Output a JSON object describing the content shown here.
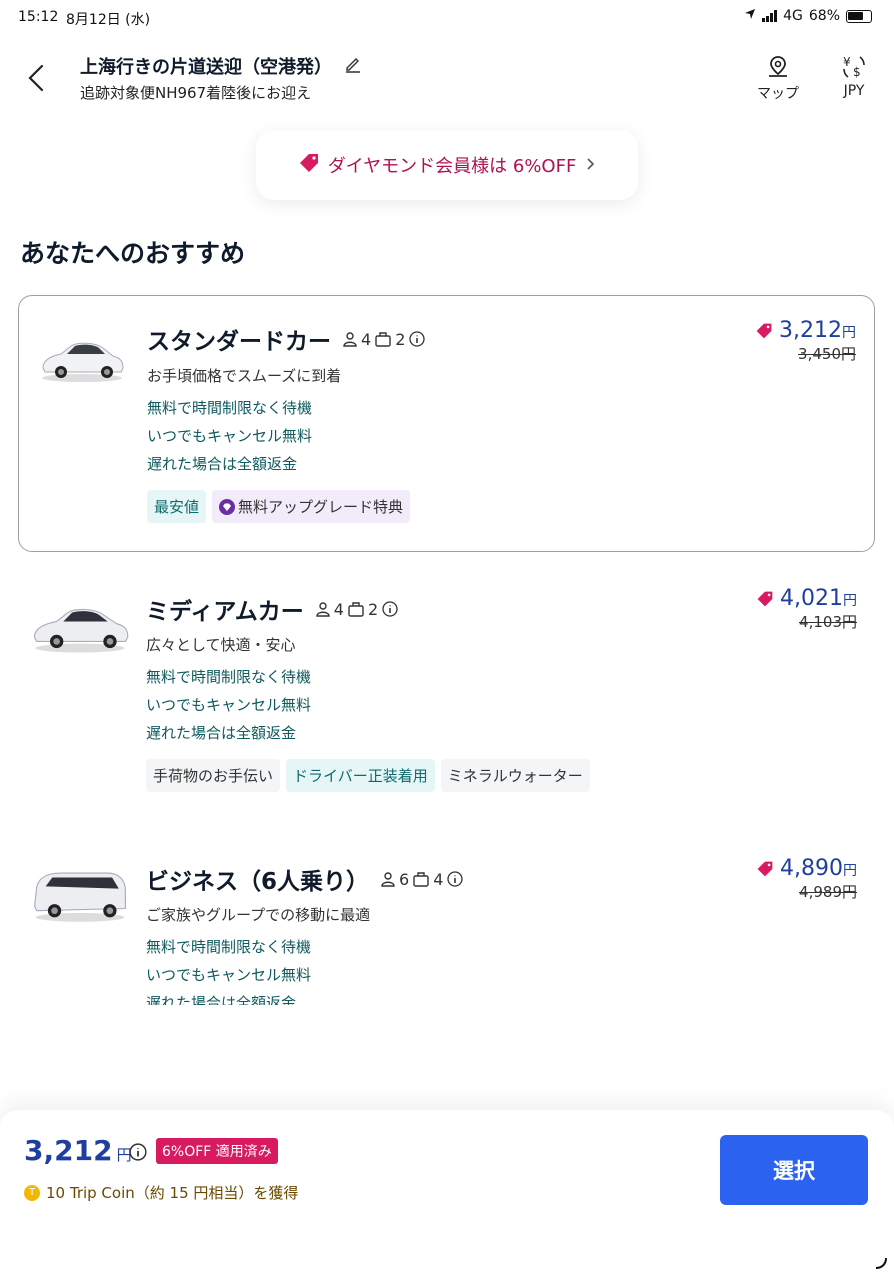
{
  "status_bar": {
    "time": "15:12",
    "date": "8月12日 (水)",
    "network": "4G",
    "battery": "68%"
  },
  "header": {
    "title": "上海行きの片道送迎（空港発）",
    "subtitle": "追跡対象便NH967着陸後にお迎え",
    "map_label": "マップ",
    "currency_label": "JPY"
  },
  "promo": {
    "text": "ダイヤモンド会員様は 6%OFF"
  },
  "section_title": "あなたへのおすすめ",
  "cars": [
    {
      "name": "スタンダードカー",
      "passengers": "4",
      "luggage": "2",
      "description": "お手頃価格でスムーズに到着",
      "features": [
        "無料で時間制限なく待機",
        "いつでもキャンセル無料",
        "遅れた場合は全額返金"
      ],
      "tags": [
        "最安値",
        "無料アップグレード特典"
      ],
      "price": "3,212",
      "old_price": "3,450円",
      "currency": "円"
    },
    {
      "name": "ミディアムカー",
      "passengers": "4",
      "luggage": "2",
      "description": "広々として快適・安心",
      "features": [
        "無料で時間制限なく待機",
        "いつでもキャンセル無料",
        "遅れた場合は全額返金"
      ],
      "tags": [
        "手荷物のお手伝い",
        "ドライバー正装着用",
        "ミネラルウォーター"
      ],
      "price": "4,021",
      "old_price": "4,103円",
      "currency": "円"
    },
    {
      "name": "ビジネス（6人乗り）",
      "passengers": "6",
      "luggage": "4",
      "description": "ご家族やグループでの移動に最適",
      "features": [
        "無料で時間制限なく待機",
        "いつでもキャンセル無料",
        "遅れた場合は全額返金"
      ],
      "price": "4,890",
      "old_price": "4,989円",
      "currency": "円"
    }
  ],
  "footer": {
    "price": "3,212",
    "currency": "円",
    "badge": "6%OFF 適用済み",
    "coin_text": "10 Trip Coin（約 15 円相当）を獲得",
    "select_label": "選択"
  },
  "colors": {
    "accent": "#2b63f0",
    "price": "#1f3f9e",
    "promo": "#b0124f",
    "badge": "#d81b60"
  }
}
